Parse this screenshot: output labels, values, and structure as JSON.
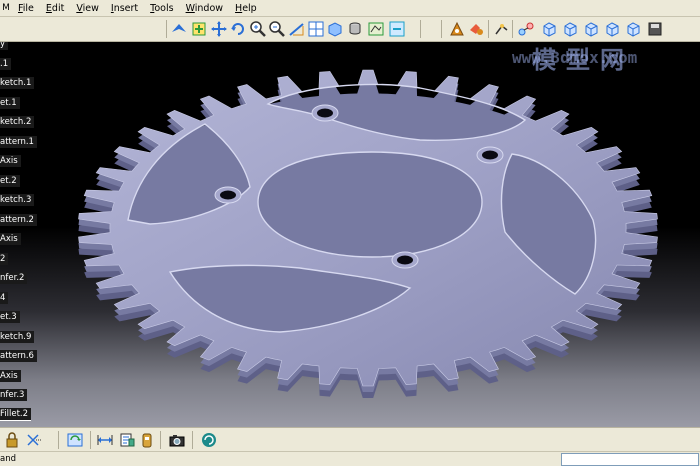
{
  "menu": [
    "File",
    "Edit",
    "View",
    "Insert",
    "Tools",
    "Window",
    "Help"
  ],
  "menu_underline": [
    "F",
    "E",
    "V",
    "I",
    "T",
    "W",
    "H"
  ],
  "app_logo": "M",
  "tree": [
    "y",
    ".1",
    "ketch.1",
    "et.1",
    "ketch.2",
    "attern.1",
    "Axis",
    "et.2",
    "ketch.3",
    "attern.2",
    "Axis",
    "2",
    "nfer.2",
    "4",
    "et.3",
    "ketch.9",
    "attern.6",
    "Axis",
    "nfer.3",
    "Fillet.2"
  ],
  "watermark": {
    "cn": "模型网",
    "url": "www.3dmox.com"
  },
  "status": {
    "left": "and",
    "input_value": ""
  },
  "colors": {
    "part": "#9ea0c4",
    "part_shadow": "#5e6088",
    "toolbar": "#ece9d8"
  },
  "icons": {
    "top": [
      "fly-mode-icon",
      "fit-all-icon",
      "pan-icon",
      "rotate-icon",
      "zoom-in-icon",
      "zoom-out-icon",
      "normal-view-icon",
      "multi-view-icon",
      "iso-view-icon",
      "view-mode-icon",
      "hide-show-icon",
      "swap-space-icon",
      "apply-material-icon",
      "render-icon",
      "measure-icon",
      "graph-icon",
      "view-front-icon",
      "view-back-icon",
      "view-left-icon",
      "view-right-icon",
      "view-top-icon",
      "save-view-icon"
    ],
    "bottom": [
      "lock-icon",
      "constraint-icon",
      "update-icon",
      "measure-between-icon",
      "properties-icon",
      "catalog-icon",
      "camera-icon",
      "analysis-icon"
    ]
  }
}
